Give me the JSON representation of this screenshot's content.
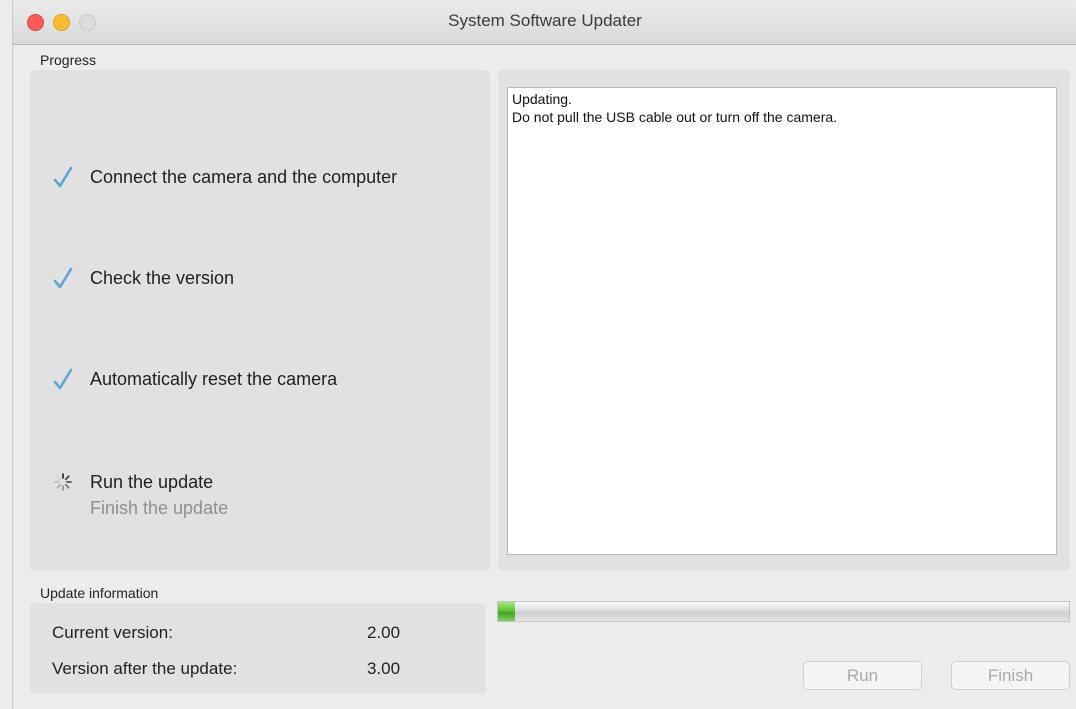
{
  "window": {
    "title": "System Software Updater"
  },
  "progress": {
    "section_label": "Progress",
    "steps": [
      {
        "label": "Connect the camera and the computer",
        "state": "done",
        "icon": "checkmark-icon"
      },
      {
        "label": "Check the version",
        "state": "done",
        "icon": "checkmark-icon"
      },
      {
        "label": "Automatically reset the camera",
        "state": "done",
        "icon": "checkmark-icon"
      },
      {
        "label": "Run the update",
        "state": "in-progress",
        "icon": "spinner-icon"
      },
      {
        "label": "Finish the update",
        "state": "pending",
        "icon": ""
      }
    ]
  },
  "log": {
    "line1": "Updating.",
    "line2": "Do not pull the USB cable out or turn off the camera."
  },
  "update_info": {
    "section_label": "Update information",
    "current_label": "Current version:",
    "current_value": "2.00",
    "after_label": "Version after the update:",
    "after_value": "3.00"
  },
  "progress_bar": {
    "fraction": 0.03
  },
  "buttons": {
    "run_label": "Run",
    "finish_label": "Finish"
  },
  "colors": {
    "check": "#5aa7d6",
    "accent_green": "#4cb827",
    "close": "#fc5b57",
    "minimize": "#fdbc2e"
  }
}
